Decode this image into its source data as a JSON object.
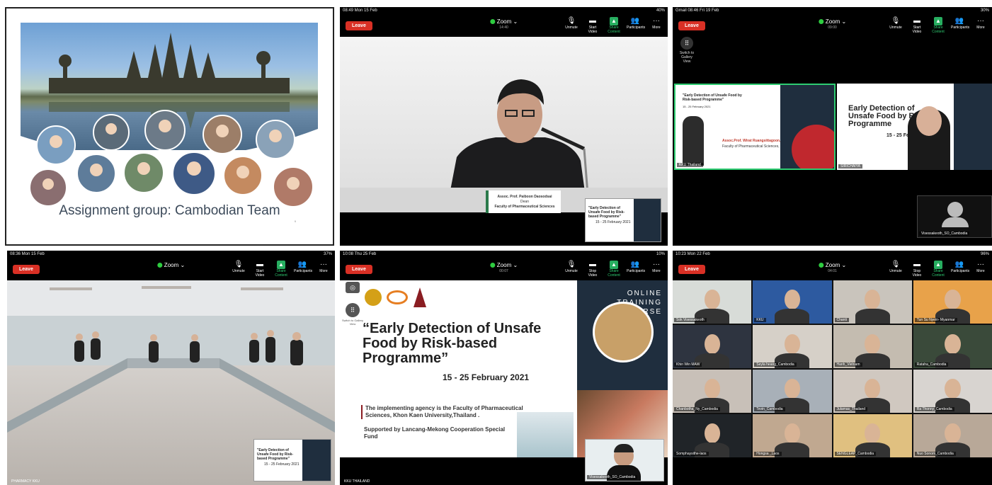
{
  "slide1": {
    "caption": "Assignment group: Cambodian Team",
    "page_marker": "9"
  },
  "zoom": {
    "leave_label": "Leave",
    "title": "Zoom",
    "tools": {
      "unmute": "Unmute",
      "start_video": "Start Video",
      "stop_video": "Stop Video",
      "share_content": "Share Content",
      "participants": "Participants",
      "more": "More"
    }
  },
  "panel2": {
    "status_time": "08:49 Mon 15 Feb",
    "battery": "40%",
    "timer": "14:40",
    "nameplate_name": "Assoc. Prof. Paiboon Daosodsai",
    "nameplate_role": "Dean",
    "nameplate_faculty": "Faculty of Pharmaceutical Sciences"
  },
  "panel3": {
    "status_time": "Gmail 08:46 Fri 19 Feb",
    "battery": "30%",
    "timer": "09:00",
    "switch_gallery": "Switch to Gallery View",
    "tile1_heading": "\"Early Detection of Unsafe Food by Risk-based Programme\"",
    "tile1_dates": "15 - 25 February 2021",
    "tile1_speaker": "Assoc.Prof. Wirat Ruangsittagoon, Ph. D.",
    "tile1_faculty": "Faculty of Pharmaceutical Sciences, KKU",
    "tile1_name": "KKU Thailand",
    "tile2_title": "Early Detection of Unsafe Food by Risk Programme",
    "tile2_dates": "15 - 25 Feb",
    "tile2_name": "SIRICHAIYA",
    "self_name": "Visessakeoth_SO_Cambodia"
  },
  "panel4": {
    "status_time": "08:36 Mon 15 Feb",
    "battery": "37%",
    "footer_name": "PHARMACY KKU"
  },
  "panel5": {
    "status_time": "10:08 Thu 25 Feb",
    "battery": "10%",
    "timer": "00:07",
    "switch_gallery": "Switch to Gallery View",
    "online_training": "ONLINE TRAINING COURSE",
    "title": "“Early Detection of Unsafe Food by Risk-based Programme”",
    "dates": "15 - 25 February 2021",
    "agency": "The implementing agency is the Faculty of Pharmaceutical Sciences, Khon Kaen University,Thailand .",
    "support": "Supported by Lancang-Mekong Cooperation Special Fund",
    "self_name": "Visessakeoth_SO_Cambodia",
    "footer_name": "KKU THAILAND"
  },
  "panel6": {
    "status_time": "10:23 Mon 22 Feb",
    "battery": "96%",
    "timer": "04:01",
    "tiles": [
      "Sok Visessakeoth",
      "KKU",
      "Chanti",
      "Tun Su Nyein- Myanmar",
      "Khin Win MAW",
      "Seyla heang_Cambodia",
      "Hanh_Vietnam",
      "Rataha_Cambodia",
      "Chanbotha_Ny_Cambodia",
      "Tevin_Cambodia",
      "Julamas_Thailand",
      "Ra Thonny_Cambodia",
      "Somphaysithe-laos",
      "Hongsa _Laos",
      "SENGLEAP_Cambodia",
      "Nuo Sonom_Cambodia"
    ]
  }
}
